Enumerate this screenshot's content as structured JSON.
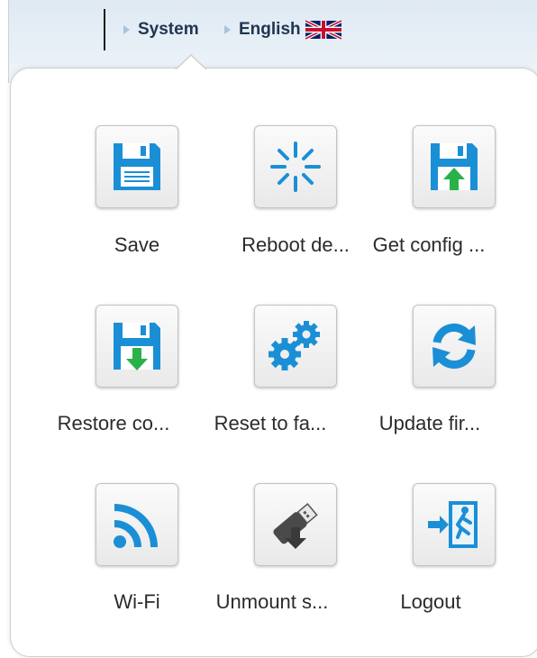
{
  "breadcrumb": {
    "system": "System",
    "language": "English",
    "language_flag_icon": "uk-flag-icon"
  },
  "menu": {
    "items": [
      {
        "label": "Save",
        "icon": "floppy-disk-icon"
      },
      {
        "label": "Reboot de...",
        "icon": "reboot-spinner-icon"
      },
      {
        "label": "Get config ...",
        "icon": "floppy-upload-icon"
      },
      {
        "label": "Restore co...",
        "icon": "floppy-download-icon"
      },
      {
        "label": "Reset to fa...",
        "icon": "gears-icon"
      },
      {
        "label": "Update fir...",
        "icon": "refresh-arrows-icon"
      },
      {
        "label": "Wi-Fi",
        "icon": "wifi-icon"
      },
      {
        "label": "Unmount s...",
        "icon": "usb-stick-icon"
      },
      {
        "label": "Logout",
        "icon": "exit-icon"
      }
    ]
  },
  "colors": {
    "icon_blue": "#1b8fd6",
    "arrow_green": "#2bb14a",
    "breadcrumb_text": "#1f3550"
  }
}
